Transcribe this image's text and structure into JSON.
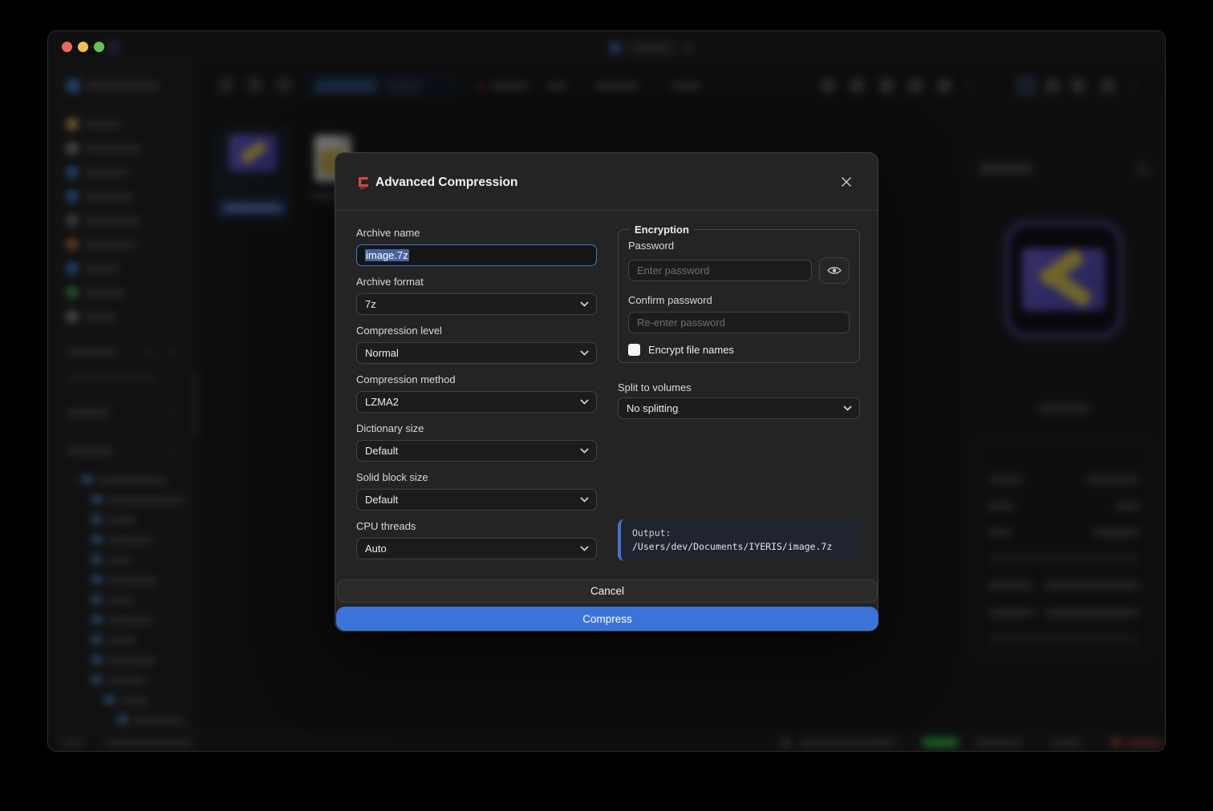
{
  "colors": {
    "accent_blue": "#3b73d9",
    "focus_border": "#3d77d6",
    "selection_highlight": "#44679f",
    "output_accent": "#4572d2",
    "traffic_red": "#ee6a5f",
    "traffic_yellow": "#f6bd50",
    "traffic_green": "#62c654",
    "logo_red": "#cf4a41"
  },
  "dialog": {
    "title": "Advanced Compression",
    "fields": [
      {
        "label": "Archive name",
        "value": "image.7z"
      },
      {
        "label": "Archive format",
        "value": "7z"
      },
      {
        "label": "Compression level",
        "value": "Normal"
      },
      {
        "label": "Compression method",
        "value": "LZMA2"
      },
      {
        "label": "Dictionary size",
        "value": "Default"
      },
      {
        "label": "Solid block size",
        "value": "Default"
      },
      {
        "label": "CPU threads",
        "value": "Auto"
      }
    ],
    "encryption": {
      "legend": "Encryption",
      "password_label": "Password",
      "password_placeholder": "Enter password",
      "confirm_label": "Confirm password",
      "confirm_placeholder": "Re-enter password",
      "encrypt_names_label": "Encrypt file names"
    },
    "split": {
      "label": "Split to volumes",
      "value": "No splitting"
    },
    "output": {
      "label": "Output:",
      "path": "/Users/dev/Documents/IYERIS/image.7z"
    },
    "footer": {
      "cancel": "Cancel",
      "compress": "Compress"
    }
  }
}
